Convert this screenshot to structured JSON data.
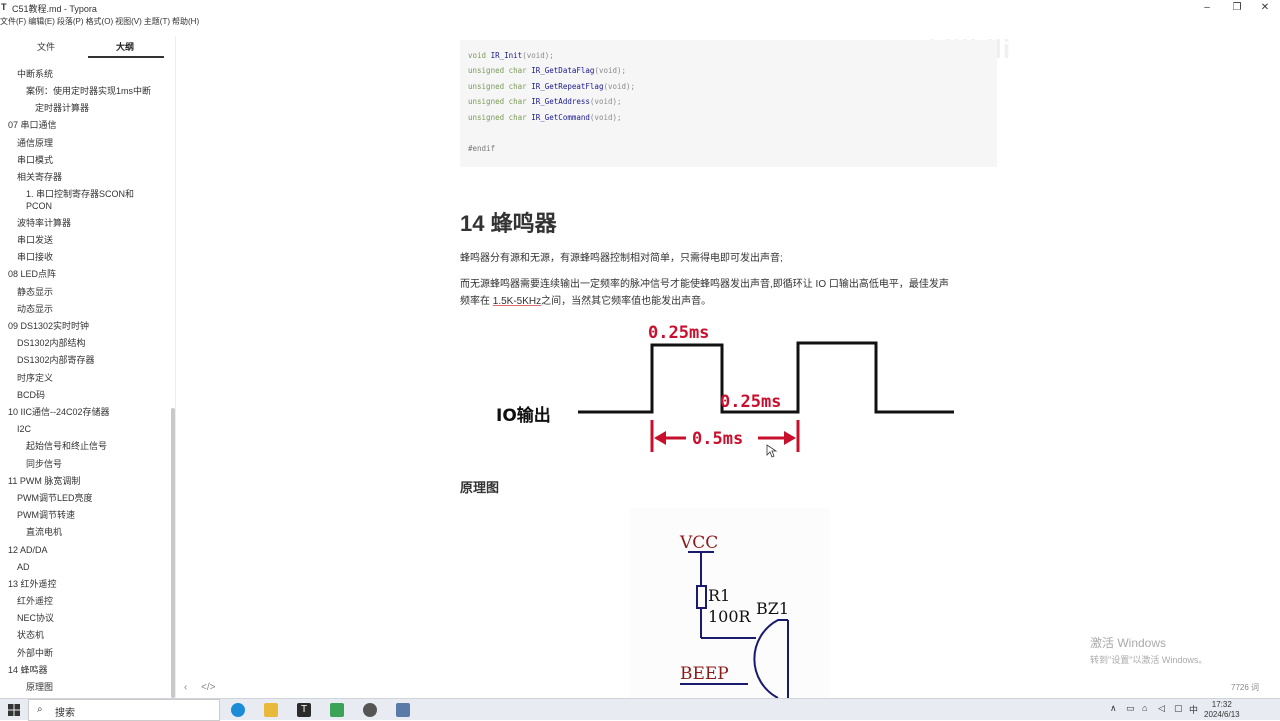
{
  "window": {
    "title": "C51教程.md - Typora",
    "app_icon": "T"
  },
  "menu": [
    "文件(F)",
    "编辑(E)",
    "段落(P)",
    "格式(O)",
    "视图(V)",
    "主题(T)",
    "帮助(H)"
  ],
  "sidebar": {
    "tabs": [
      "文件",
      "大纲"
    ],
    "outline": [
      "中断系统",
      "案例：使用定时器实现1ms中断",
      "定时器计算器",
      "07 串口通信",
      "通信原理",
      "串口模式",
      "相关寄存器",
      "1. 串口控制寄存器SCON和",
      "PCON",
      "波特率计算器",
      "串口发送",
      "串口接收",
      "08 LED点阵",
      "静态显示",
      "动态显示",
      "09 DS1302实时时钟",
      "DS1302内部结构",
      "DS1302内部寄存器",
      "时序定义",
      "BCD码",
      "10 IIC通信--24C02存储器",
      "I2C",
      "起始信号和终止信号",
      "同步信号",
      "11 PWM 脉宽调制",
      "PWM调节LED亮度",
      "PWM调节转速",
      "直流电机",
      "12 AD/DA",
      "AD",
      "13 红外遥控",
      "红外遥控",
      "NEC协议",
      "状态机",
      "外部中断",
      "14 蜂鸣器",
      "原理图"
    ],
    "footer": {
      "back": "‹",
      "source": "</>"
    }
  },
  "code": {
    "lines": [
      [
        "void",
        "IR_Init",
        "(void);"
      ],
      [
        "unsigned char",
        "IR_GetDataFlag",
        "(void);"
      ],
      [
        "unsigned char",
        "IR_GetRepeatFlag",
        "(void);"
      ],
      [
        "unsigned char",
        "IR_GetAddress",
        "(void);"
      ],
      [
        "unsigned char",
        "IR_GetCommand",
        "(void);"
      ]
    ],
    "endif": "#endif"
  },
  "doc": {
    "heading": "14 蜂鸣器",
    "p1": "蜂鸣器分有源和无源，有源蜂鸣器控制相对简单，只需得电即可发出声音;",
    "p2a": "而无源蜂鸣器需要连续输出一定频率的脉冲信号才能使蜂鸣器发出声音,即循环让 IO 口输出高低电平，最佳发声",
    "p2b_pre": "频率在 ",
    "p2b_ul": "1.5K-5KHz",
    "p2b_post": "之间，当然其它频率值也能发出声音。",
    "subheading": "原理图"
  },
  "figure": {
    "io_label": "IO输出",
    "high_label": "0.25ms",
    "low_label": "0.25ms",
    "period_label": "0.5ms"
  },
  "schematic": {
    "vcc": "VCC",
    "r1": "R1",
    "r1_value": "100R",
    "bz1": "BZ1",
    "beep": "BEEP"
  },
  "watermark": "bilibili",
  "activation": {
    "line1": "激活 Windows",
    "line2": "转到\"设置\"以激活 Windows。"
  },
  "word_count": "7726 词",
  "taskbar": {
    "search_placeholder": "搜索",
    "ime": "中",
    "time": "17:32",
    "date": "2024/6/13"
  },
  "colors": {
    "accent_red": "#c8102e",
    "sidebar_scrollbar": "#c8c8c8"
  }
}
